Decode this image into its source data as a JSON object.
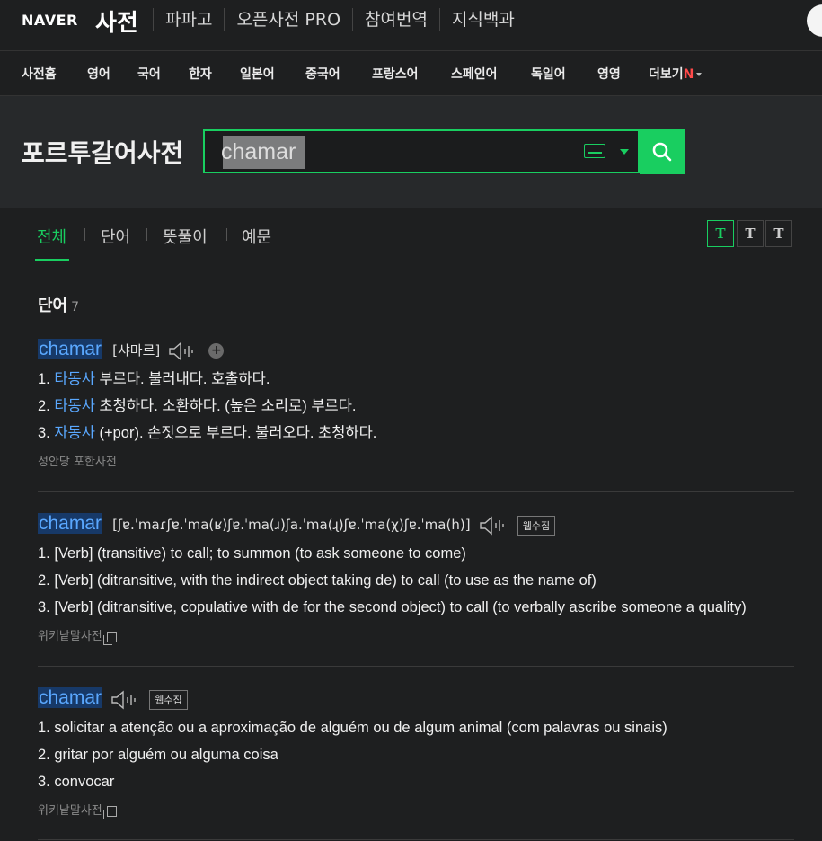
{
  "header": {
    "brand": "NAVER",
    "service": "사전",
    "links": [
      "파파고",
      "오픈사전 PRO",
      "참여번역",
      "지식백과"
    ]
  },
  "nav": {
    "items": [
      "사전홈",
      "영어",
      "국어",
      "한자",
      "일본어",
      "중국어",
      "프랑스어",
      "스페인어",
      "독일어",
      "영영"
    ],
    "more_label": "더보기",
    "more_badge": "N"
  },
  "search": {
    "title": "포르투갈어사전",
    "query": "chamar"
  },
  "tabs": {
    "items": [
      "전체",
      "단어",
      "뜻풀이",
      "예문"
    ],
    "active": 0,
    "font_sizes": [
      "T",
      "T",
      "T"
    ]
  },
  "results": {
    "section_title": "단어",
    "section_count": "7",
    "entries": [
      {
        "word": "chamar",
        "pron": "[샤마르]",
        "defs": [
          {
            "num": "1.",
            "pos": "타동사",
            "text": "부르다. 불러내다. 호출하다."
          },
          {
            "num": "2.",
            "pos": "타동사",
            "text": "초청하다. 소환하다. (높은 소리로) 부르다."
          },
          {
            "num": "3.",
            "pos": "자동사",
            "text": "(+por). 손짓으로 부르다. 불러오다. 초청하다."
          }
        ],
        "source": "성안당 포한사전"
      },
      {
        "word": "chamar",
        "pron": "[ʃɐ.ˈmaɾʃɐ.ˈma(ʁ)ʃɐ.ˈma(ɹ)ʃa.ˈma(ɻ)ʃɐ.ˈma(χ)ʃɐ.ˈma(h)]",
        "badge": "웹수집",
        "defs": [
          {
            "num": "1.",
            "text": "[Verb] (transitive) to call; to summon (to ask someone to come)"
          },
          {
            "num": "2.",
            "text": "[Verb] (ditransitive, with the indirect object taking de) to call (to use as the name of)"
          },
          {
            "num": "3.",
            "text": "[Verb] (ditransitive, copulative with de for the second object) to call (to verbally ascribe someone a quality)"
          }
        ],
        "source": "위키낱말사전"
      },
      {
        "word": "chamar",
        "badge": "웹수집",
        "defs": [
          {
            "num": "1.",
            "text": "solicitar a atenção ou a aproximação de alguém ou de algum animal (com palavras ou sinais)"
          },
          {
            "num": "2.",
            "text": "gritar por alguém ou alguma coisa"
          },
          {
            "num": "3.",
            "text": "convocar"
          }
        ],
        "source": "위키낱말사전"
      }
    ]
  },
  "colors": {
    "accent": "#19ce60",
    "link": "#5aa8ff",
    "background": "#1e1f20"
  }
}
